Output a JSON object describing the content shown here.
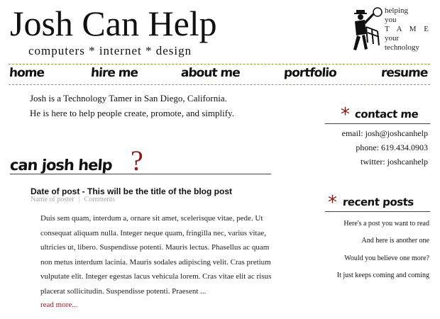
{
  "header": {
    "title": "Josh Can Help",
    "tagline": "computers * internet * design",
    "slogan": [
      "helping",
      "you",
      "T A M E",
      "your",
      "technology"
    ]
  },
  "nav": {
    "items": [
      {
        "label": "home"
      },
      {
        "label": "hire me"
      },
      {
        "label": "about me"
      },
      {
        "label": "portfolio"
      },
      {
        "label": "resume"
      }
    ]
  },
  "intro": {
    "line1": "Josh is a Technology Tamer in San Diego, California.",
    "line2": "He is here to help people create, promote, and simplify."
  },
  "section": {
    "heading": "can josh help",
    "mark": "?"
  },
  "post": {
    "title": "Date of post - This will be the title of the blog post",
    "author": "Name of poster",
    "comments": "Comments",
    "separator": "|",
    "body": "Duis sem quam, interdum a, ornare sit amet, scelerisque vitae, pede. Ut consequat aliquam nulla. Integer neque quam, fringilla nec, varius vitae, ultricies ut, libero. Suspendisse potenti. Mauris lectus. Phasellus ac quam non metus interdum lacinia. Mauris sodales adipiscing velit. Cras pretium vulputate elit. Integer egestas lacus vehicula lorem. Cras vitae elit ac risus placerat sollicitudin. Suspendisse potenti. Praesent ...",
    "read_more": "read more..."
  },
  "sidebar": {
    "contact": {
      "heading": "contact me",
      "star": "*",
      "email": "email: josh@joshcanhelp",
      "phone": "phone: 619.434.0903",
      "twitter": "twitter: joshcanhelp"
    },
    "recent": {
      "heading": "recent posts",
      "star": "*",
      "items": [
        "Here's a post you want to read",
        "And here is another one",
        "Would you believe one more?",
        "It just keeps coming and coming"
      ]
    }
  },
  "colors": {
    "accent": "#8b1a1a",
    "nav_border": "#b08c4a"
  },
  "icons": {
    "logo": "man-with-chair-whip-icon"
  }
}
